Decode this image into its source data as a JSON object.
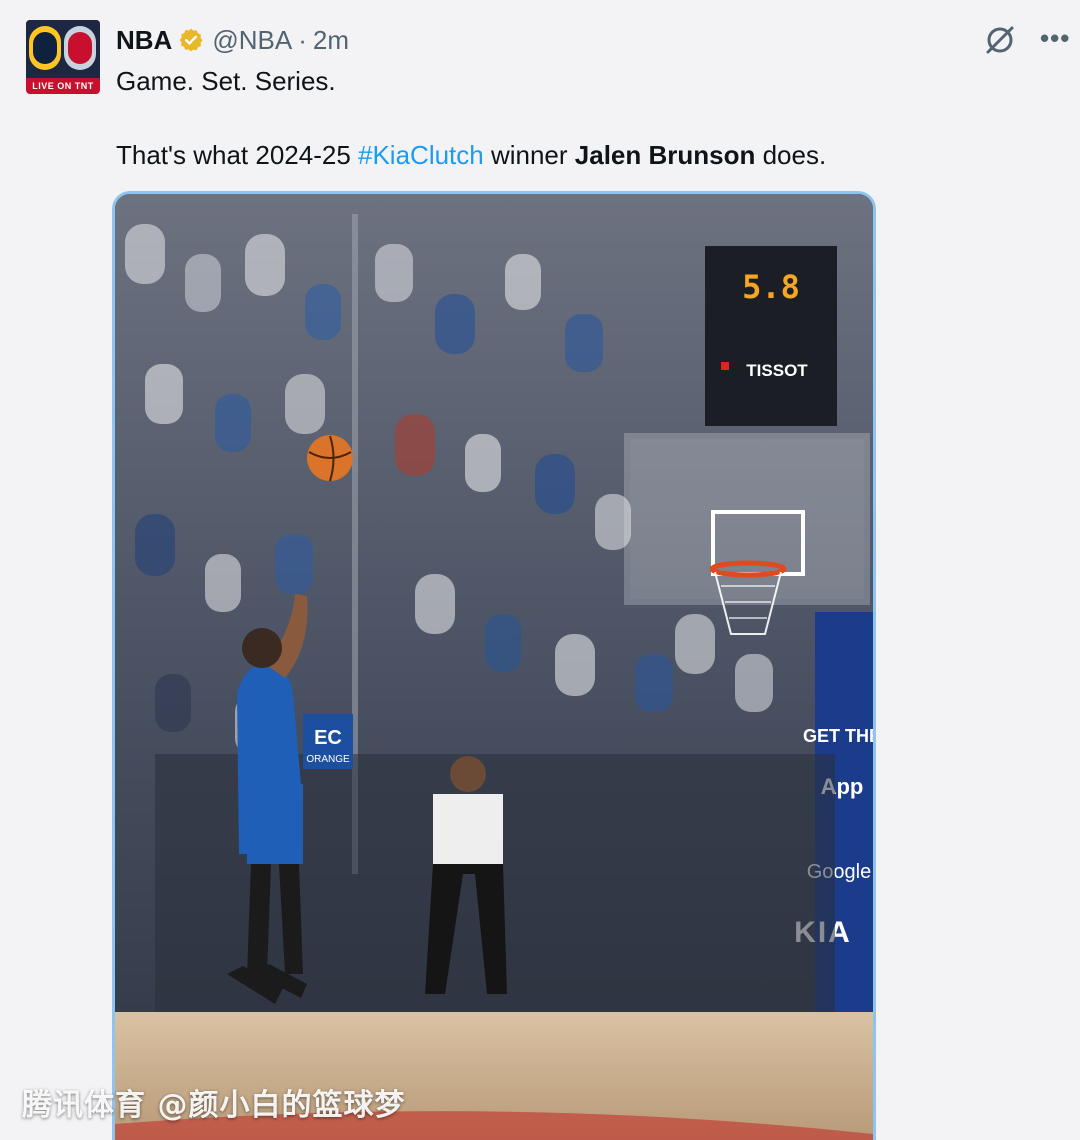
{
  "account": {
    "name": "NBA",
    "handle": "@NBA",
    "separator": "·",
    "time": "2m",
    "avatar_band": "LIVE ON TNT"
  },
  "tweet": {
    "line1": "Game. Set. Series.",
    "line2_prefix": "That's what 2024-25 ",
    "hashtag": "#KiaClutch",
    "line2_middle": " winner ",
    "player": "Jalen Brunson",
    "line2_suffix": " does."
  },
  "photo": {
    "shot_clock": "5.8",
    "brand": "TISSOT",
    "signage_vertical": "GET THE",
    "signage_app": "App",
    "sponsor_google": "Google",
    "sponsor_kia": "KIA",
    "banner": "EC",
    "banner_sub": "ORANGE"
  },
  "watermark": "腾讯体育 @颜小白的篮球梦",
  "icons": [
    "verified-badge-icon",
    "grok-icon",
    "more-icon"
  ],
  "colors": {
    "link": "#1d9bf0",
    "verified": "#e8b829",
    "handle": "#536471",
    "media_border": "#8ec5f0"
  }
}
